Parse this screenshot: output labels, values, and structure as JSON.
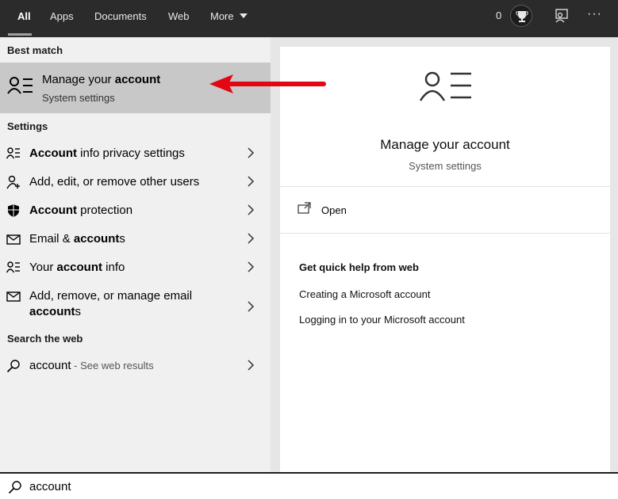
{
  "topbar": {
    "tabs": [
      {
        "label": "All",
        "active": true
      },
      {
        "label": "Apps"
      },
      {
        "label": "Documents"
      },
      {
        "label": "Web"
      },
      {
        "label": "More"
      }
    ],
    "points": "0",
    "icons": [
      "trophy-icon",
      "feedback-icon",
      "more-options-icon"
    ],
    "more_options": "···"
  },
  "left": {
    "best_match_header": "Best match",
    "best_match": {
      "title_plain": "Manage your ",
      "title_bold": "account",
      "subtitle": "System settings",
      "icon": "account-person-list-icon"
    },
    "settings_header": "Settings",
    "settings": [
      {
        "icon": "person-list-icon",
        "bold": "Account",
        "rest": " info privacy settings"
      },
      {
        "icon": "add-person-icon",
        "text": "Add, edit, or remove other users"
      },
      {
        "icon": "shield-icon",
        "bold": "Account",
        "rest": " protection"
      },
      {
        "icon": "mail-icon",
        "pre": "Email & ",
        "bold": "account",
        "rest": "s"
      },
      {
        "icon": "person-list-icon",
        "pre": "Your ",
        "bold": "account",
        "rest": " info"
      },
      {
        "icon": "mail-icon",
        "line1": "Add, remove, or manage email",
        "bold2": "account",
        "rest2": "s"
      }
    ],
    "web_header": "Search the web",
    "web_result": {
      "term": "account",
      "suffix": " - See web results"
    }
  },
  "right": {
    "title": "Manage your account",
    "subtitle": "System settings",
    "open_label": "Open",
    "help_title": "Get quick help from web",
    "help_links": [
      "Creating a Microsoft account",
      "Logging in to your Microsoft account"
    ]
  },
  "search": {
    "value": "account"
  },
  "colors": {
    "topbar": "#2b2b2b",
    "selected": "#c8c8c8",
    "arrow": "#e30613"
  }
}
